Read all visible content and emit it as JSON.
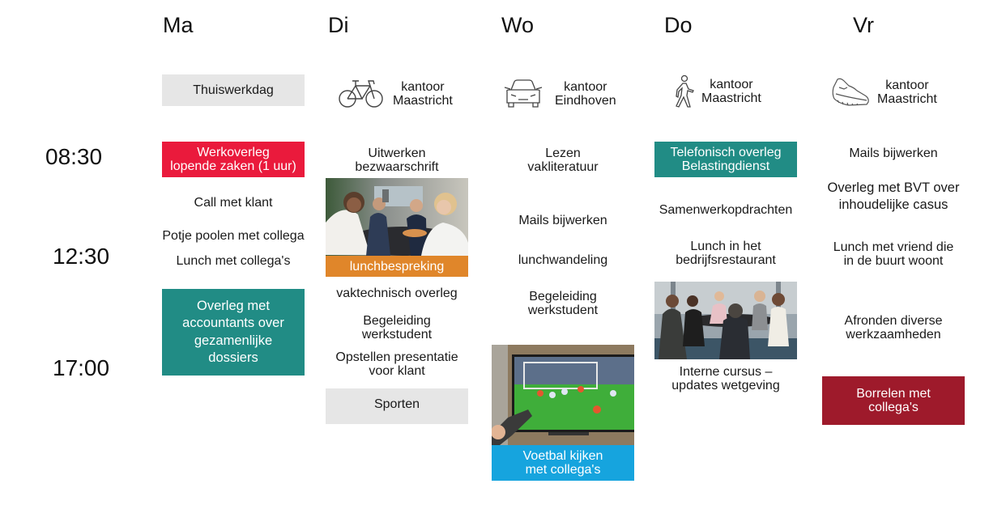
{
  "days": [
    "Ma",
    "Di",
    "Wo",
    "Do",
    "Vr"
  ],
  "times": [
    "08:30",
    "12:30",
    "17:00"
  ],
  "colors": {
    "grey_box": "#e6e6e6",
    "red": "#ea1a3c",
    "teal": "#218c85",
    "orange": "#e0862a",
    "blue": "#16a4de",
    "darkred": "#9e1a2b"
  },
  "locations": {
    "ma": {
      "label": "Thuiswerkdag"
    },
    "di": {
      "icon": "bicycle-icon",
      "line1": "kantoor",
      "line2": "Maastricht"
    },
    "wo": {
      "icon": "car-icon",
      "line1": "kantoor",
      "line2": "Eindhoven"
    },
    "do": {
      "icon": "walking-person-icon",
      "line1": "kantoor",
      "line2": "Maastricht"
    },
    "vr": {
      "icon": "sneaker-icon",
      "line1": "kantoor",
      "line2": "Maastricht"
    }
  },
  "ma": {
    "werkoverleg": [
      "Werkoverleg",
      "lopende zaken (1 uur)"
    ],
    "call": "Call met klant",
    "poolen": "Potje poolen met collega",
    "lunch": "Lunch met collega's",
    "overleg": [
      "Overleg met",
      "accountants over",
      "gezamenlijke",
      "dossiers"
    ]
  },
  "di": {
    "uitwerken": [
      "Uitwerken",
      "bezwaarschrift"
    ],
    "lunch_caption": "lunchbespreking",
    "vaktechnisch": "vaktechnisch overleg",
    "begeleiding": [
      "Begeleiding",
      "werkstudent"
    ],
    "presentatie": [
      "Opstellen presentatie",
      "voor klant"
    ],
    "sporten": "Sporten"
  },
  "wo": {
    "lezen": [
      "Lezen",
      "vakliteratuur"
    ],
    "mails": "Mails bijwerken",
    "lunchwandeling": "lunchwandeling",
    "begeleiding": [
      "Begeleiding",
      "werkstudent"
    ],
    "voetbal_caption": [
      "Voetbal kijken",
      "met collega's"
    ]
  },
  "do": {
    "telefonisch": [
      "Telefonisch overleg",
      "Belastingdienst"
    ],
    "samenwerk": "Samenwerkopdrachten",
    "lunch": [
      "Lunch in het",
      "bedrijfsrestaurant"
    ],
    "cursus": [
      "Interne cursus –",
      "updates wetgeving"
    ]
  },
  "vr": {
    "mails": "Mails bijwerken",
    "overleg_bvt": [
      "Overleg met BVT over",
      "inhoudelijke casus"
    ],
    "lunch": [
      "Lunch met vriend die",
      "in de buurt woont"
    ],
    "afronden": [
      "Afronden diverse",
      "werkzaamheden"
    ],
    "borrelen": [
      "Borrelen met",
      "collega's"
    ]
  }
}
